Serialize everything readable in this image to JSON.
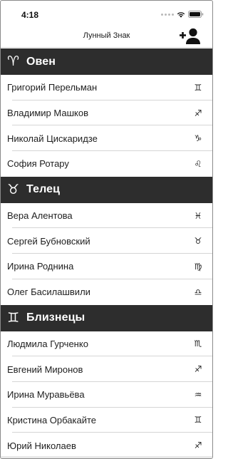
{
  "status_bar": {
    "time": "4:18"
  },
  "nav": {
    "title": "Лунный Знак"
  },
  "sections": [
    {
      "symbol": "♈",
      "title": "Овен",
      "items": [
        {
          "name": "Григорий Перельман",
          "sign": "♊"
        },
        {
          "name": "Владимир Машков",
          "sign": "♐"
        },
        {
          "name": "Николай Цискаридзе",
          "sign": "♑"
        },
        {
          "name": "София Ротару",
          "sign": "♌"
        }
      ]
    },
    {
      "symbol": "♉",
      "title": "Телец",
      "items": [
        {
          "name": "Вера Алентова",
          "sign": "♓"
        },
        {
          "name": "Сергей Бубновский",
          "sign": "♉"
        },
        {
          "name": "Ирина Роднина",
          "sign": "♍"
        },
        {
          "name": "Олег Басилашвили",
          "sign": "♎"
        }
      ]
    },
    {
      "symbol": "♊",
      "title": "Близнецы",
      "items": [
        {
          "name": "Людмила Гурченко",
          "sign": "♏"
        },
        {
          "name": "Евгений Миронов",
          "sign": "♐"
        },
        {
          "name": "Ирина Муравьёва",
          "sign": "♒"
        },
        {
          "name": "Кристина Орбакайте",
          "sign": "♊"
        },
        {
          "name": "Юрий Николаев",
          "sign": "♐"
        }
      ]
    }
  ],
  "colors": {
    "section_bg": "#2d2d2d",
    "section_text": "#ffffff",
    "separator": "#d5d5d5"
  },
  "icons": {
    "add_user": "add-user-icon",
    "wifi": "wifi-icon",
    "battery": "battery-icon"
  }
}
